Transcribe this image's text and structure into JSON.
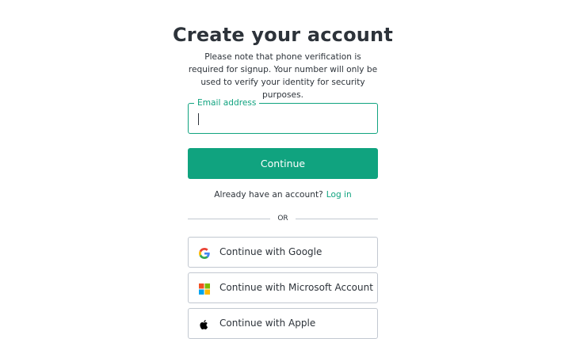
{
  "header": {
    "title": "Create your account",
    "subtitle": "Please note that phone verification is required for signup. Your number will only be used to verify your identity for security purposes."
  },
  "email": {
    "label": "Email address",
    "value": "",
    "placeholder": ""
  },
  "continue_button": {
    "label": "Continue"
  },
  "login": {
    "prompt": "Already have an account?",
    "link_label": "Log in"
  },
  "divider": {
    "text": "OR"
  },
  "social": [
    {
      "label": "Continue with Google",
      "icon": "google-logo-icon"
    },
    {
      "label": "Continue with Microsoft Account",
      "icon": "microsoft-logo-icon"
    },
    {
      "label": "Continue with Apple",
      "icon": "apple-logo-icon"
    }
  ],
  "colors": {
    "accent": "#10a37f",
    "text": "#2d333a",
    "border": "#c2c8d0",
    "background": "#ffffff"
  }
}
